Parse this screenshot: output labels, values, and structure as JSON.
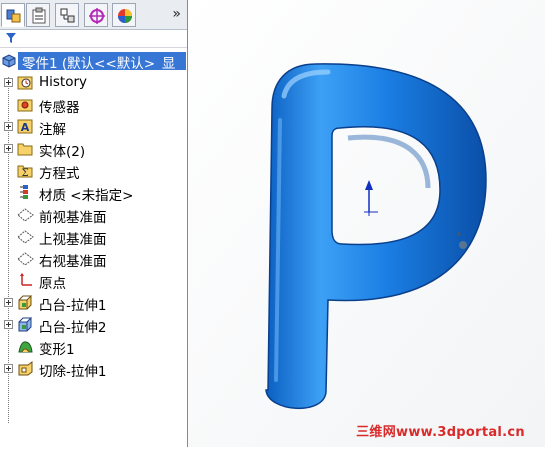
{
  "tabs": {
    "items": [
      {
        "name": "featuremanager",
        "icon": "feature-tree-icon"
      },
      {
        "name": "propertymanager",
        "icon": "property-manager-icon"
      },
      {
        "name": "configurationmanager",
        "icon": "configuration-manager-icon"
      },
      {
        "name": "dimxpertmanager",
        "icon": "dimxpert-icon"
      },
      {
        "name": "displaymanager",
        "icon": "display-manager-icon"
      }
    ],
    "more_label": "»"
  },
  "filter": {
    "icon": "filter-icon"
  },
  "tree": {
    "root": {
      "label": "零件1 (默认<<默认>_显",
      "icon": "part-icon"
    },
    "items": [
      {
        "label": "History",
        "icon": "history-icon",
        "expandable": true
      },
      {
        "label": "传感器",
        "icon": "sensor-icon",
        "expandable": false
      },
      {
        "label": "注解",
        "icon": "annotation-icon",
        "expandable": true
      },
      {
        "label": "实体(2)",
        "icon": "solid-bodies-folder-icon",
        "expandable": true
      },
      {
        "label": "方程式",
        "icon": "equations-icon",
        "expandable": false
      },
      {
        "label": "材质 <未指定>",
        "icon": "material-icon",
        "expandable": false
      },
      {
        "label": "前视基准面",
        "icon": "plane-icon",
        "expandable": false
      },
      {
        "label": "上视基准面",
        "icon": "plane-icon",
        "expandable": false
      },
      {
        "label": "右视基准面",
        "icon": "plane-icon",
        "expandable": false
      },
      {
        "label": "原点",
        "icon": "origin-icon",
        "expandable": false
      },
      {
        "label": "凸台-拉伸1",
        "icon": "boss-extrude-icon",
        "expandable": true
      },
      {
        "label": "凸台-拉伸2",
        "icon": "boss-extrude-icon",
        "expandable": true
      },
      {
        "label": "变形1",
        "icon": "deform-icon",
        "expandable": false
      },
      {
        "label": "切除-拉伸1",
        "icon": "cut-extrude-icon",
        "expandable": true
      }
    ]
  },
  "viewport": {
    "model": "letter-p-3d-model",
    "model_color": "#1f7fe0",
    "watermark": "三维网www.3dportal.cn"
  }
}
